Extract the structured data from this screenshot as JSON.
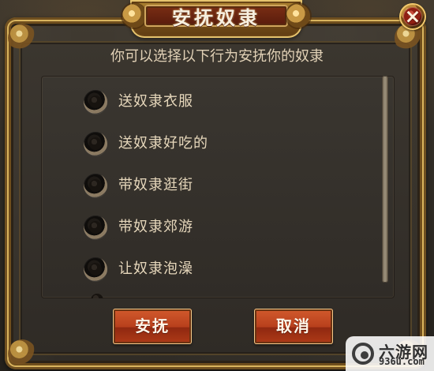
{
  "dialog": {
    "title": "安抚奴隶",
    "prompt": "你可以选择以下行为安抚你的奴隶",
    "options": [
      {
        "label": "送奴隶衣服",
        "selected": false
      },
      {
        "label": "送奴隶好吃的",
        "selected": false
      },
      {
        "label": "带奴隶逛街",
        "selected": false
      },
      {
        "label": "带奴隶郊游",
        "selected": false
      },
      {
        "label": "让奴隶泡澡",
        "selected": false
      }
    ],
    "buttons": {
      "confirm": "安抚",
      "cancel": "取消"
    },
    "close_symbol": "×"
  },
  "watermark": {
    "title": "六游网",
    "subtitle": "936u.com"
  },
  "colors": {
    "title_plate": "#7c2f14",
    "button": "#b73f1c",
    "text": "#e6d7bb"
  },
  "icons": {
    "close": "close-icon",
    "radio": "radio-icon",
    "watermark": "site-logo-icon"
  }
}
